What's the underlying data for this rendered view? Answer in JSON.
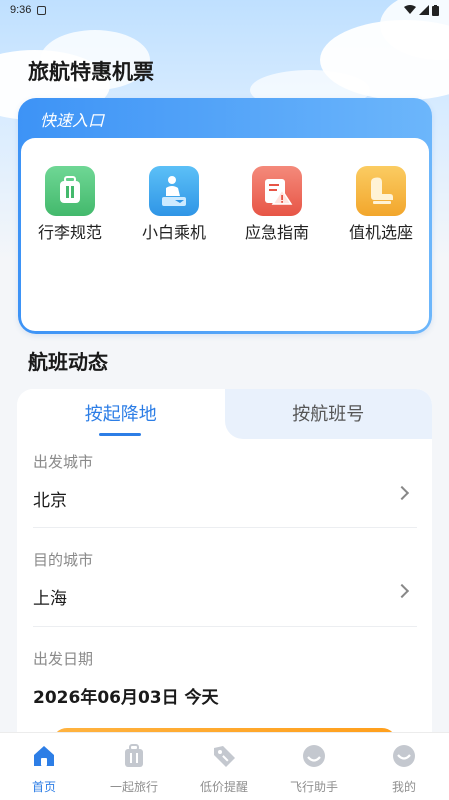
{
  "status_bar": {
    "time": "9:36"
  },
  "page_title": "旅航特惠机票",
  "quick_entry": {
    "title": "快速入口",
    "items": [
      {
        "label": "行李规范",
        "icon": "luggage-icon",
        "color": "#4fc47b"
      },
      {
        "label": "小白乘机",
        "icon": "passenger-icon",
        "color": "#3ea3ee"
      },
      {
        "label": "应急指南",
        "icon": "emergency-guide-icon",
        "color": "#ee6559"
      },
      {
        "label": "值机选座",
        "icon": "seat-icon",
        "color": "#f5b43b"
      }
    ]
  },
  "flight_status": {
    "title": "航班动态",
    "tabs": [
      {
        "label": "按起降地",
        "active": true
      },
      {
        "label": "按航班号",
        "active": false
      }
    ],
    "fields": {
      "departure_label": "出发城市",
      "departure_value": "北京",
      "destination_label": "目的城市",
      "destination_value": "上海",
      "date_label": "出发日期",
      "date_value": "2026年06月03日 今天"
    }
  },
  "bottom_nav": [
    {
      "label": "首页",
      "icon": "home-icon",
      "active": true
    },
    {
      "label": "一起旅行",
      "icon": "suitcase-icon",
      "active": false
    },
    {
      "label": "低价提醒",
      "icon": "price-tag-icon",
      "active": false
    },
    {
      "label": "飞行助手",
      "icon": "smile-icon",
      "active": false
    },
    {
      "label": "我的",
      "icon": "profile-icon",
      "active": false
    }
  ],
  "colors": {
    "accent": "#2d7ee6",
    "inactive": "#c4c8cf"
  }
}
